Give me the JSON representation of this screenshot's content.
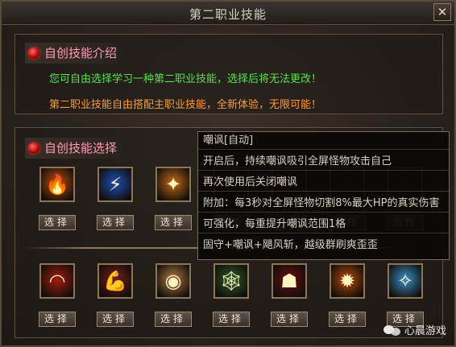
{
  "window": {
    "title": "第二职业技能",
    "close_glyph": "✕"
  },
  "intro": {
    "heading": "自创技能介绍",
    "line1": "您可自由选择学习一种第二职业技能，选择后将无法更改！",
    "line2": "第二职业技能自由搭配主职业技能，全新体验，无限可能！",
    "line1_color": "#55e34a",
    "line2_color": "#ff9a2e"
  },
  "select": {
    "heading": "自创技能选择",
    "button_label": "选择",
    "row1": [
      {
        "icon": "fire-slash-icon",
        "glyph": "🔥",
        "bg": "#c24f0a"
      },
      {
        "icon": "lightning-icon",
        "glyph": "⚡",
        "bg": "#1f4fb5"
      },
      {
        "icon": "flame-wave-icon",
        "glyph": "✦",
        "bg": "#c36a14"
      },
      {
        "icon": "hidden-skill-icon-4",
        "glyph": "",
        "bg": "#3b2a1a"
      },
      {
        "icon": "hidden-skill-icon-5",
        "glyph": "",
        "bg": "#3b2a1a"
      },
      {
        "icon": "hidden-skill-icon-6",
        "glyph": "",
        "bg": "#3b2a1a"
      },
      {
        "icon": "hidden-skill-icon-7",
        "glyph": "",
        "bg": "#3b2a1a"
      }
    ],
    "row2": [
      {
        "icon": "fire-arc-icon",
        "glyph": "◠",
        "bg": "#a61c0d"
      },
      {
        "icon": "strength-arm-icon",
        "glyph": "💪",
        "bg": "#7a1e18"
      },
      {
        "icon": "eye-icon",
        "glyph": "◉",
        "bg": "#b07a45"
      },
      {
        "icon": "spider-web-icon",
        "glyph": "🕸",
        "bg": "#2f5a2a"
      },
      {
        "icon": "hooded-figure-icon",
        "glyph": "☗",
        "bg": "#6a0d0d"
      },
      {
        "icon": "flame-burst-icon",
        "glyph": "✹",
        "bg": "#b64a08"
      },
      {
        "icon": "holy-figure-icon",
        "glyph": "✧",
        "bg": "#3a8fc8"
      }
    ]
  },
  "tooltip": {
    "lines": [
      {
        "text": "嘲讽[自动]",
        "color": "#e8dfcf"
      },
      {
        "text": "开启后，持续嘲讽吸引全屏怪物攻击自己",
        "color": "#e8dfcf"
      },
      {
        "text": "再次使用后关闭嘲讽",
        "color": "#e8dfcf"
      },
      {
        "text": "附加：每3秒对全屏怪物切割8%最大HP的真实伤害",
        "color": "#e8dfcf"
      },
      {
        "text": "可强化，每重提升嘲讽范围1格",
        "color": "#e8dfcf"
      },
      {
        "text": "固守+嘲讽+飓风斩，越级群刷爽歪歪",
        "color": "#e8dfcf"
      }
    ]
  },
  "watermark": {
    "text": "心晨游戏"
  }
}
